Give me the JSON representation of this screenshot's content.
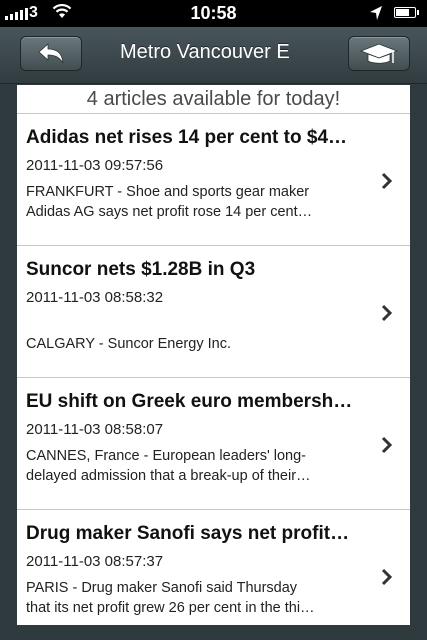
{
  "status_bar": {
    "carrier": "3",
    "time": "10:58",
    "signal_bars": 5,
    "battery_level": 0.75
  },
  "nav": {
    "title": "Metro Vancouver E",
    "back_icon": "back-arrow-icon",
    "home_icon": "graduation-cap-icon"
  },
  "summary": "4 articles available for today!",
  "articles": [
    {
      "title": "Adidas net rises 14 per cent to $4…",
      "date": "2011-11-03 09:57:56",
      "summary_line1": "FRANKFURT - Shoe and sports gear maker",
      "summary_line2": "Adidas AG says net profit rose 14 per cent…"
    },
    {
      "title": "Suncor nets $1.28B in Q3",
      "date": "2011-11-03 08:58:32",
      "summary_line1": "",
      "summary_line2": "CALGARY - Suncor Energy Inc."
    },
    {
      "title": "EU shift on Greek euro membersh…",
      "date": "2011-11-03 08:58:07",
      "summary_line1": "CANNES, France - European leaders' long-",
      "summary_line2": "delayed admission that a break-up of their…"
    },
    {
      "title": "Drug maker Sanofi says net profit…",
      "date": "2011-11-03 08:57:37",
      "summary_line1": "PARIS - Drug maker Sanofi said Thursday",
      "summary_line2": "that its net profit grew 26 per cent in the thi…"
    }
  ],
  "colors": {
    "nav_background": "#3c474b",
    "content_background": "#ffffff",
    "divider": "#c8c8c8"
  }
}
